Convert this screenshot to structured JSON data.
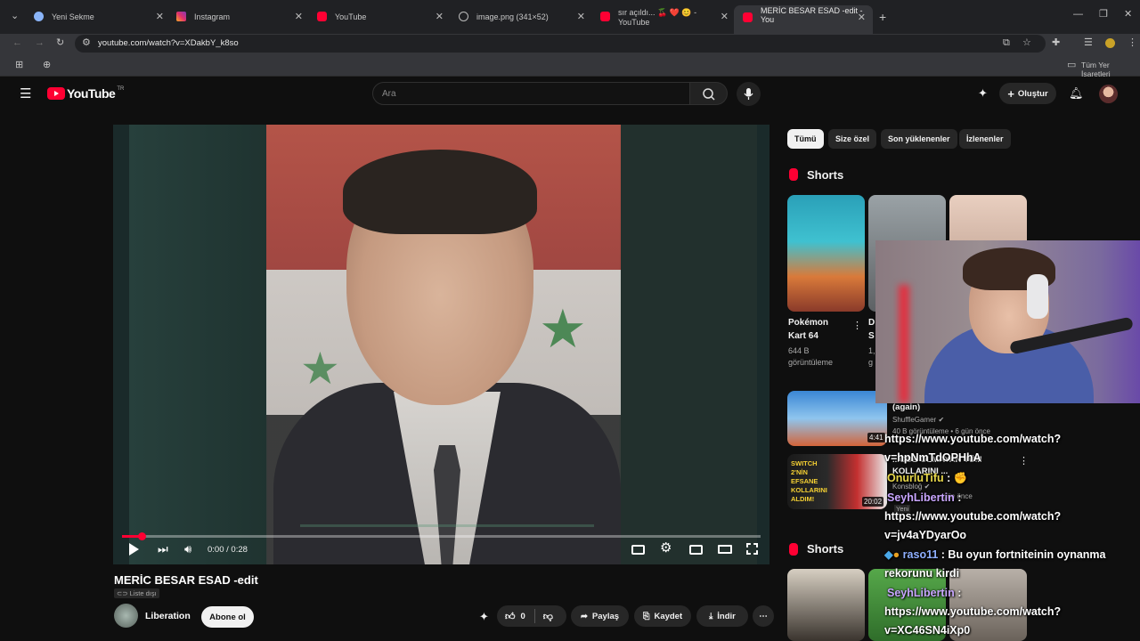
{
  "browser": {
    "tabs": [
      {
        "title": "Yeni Sekme"
      },
      {
        "title": "Instagram"
      },
      {
        "title": "YouTube"
      },
      {
        "title": "image.png (341×52)"
      },
      {
        "title": "sır açıldı... 🍒 ❤️ 😊 - YouTube"
      },
      {
        "title": "MERİC BESAR ESAD -edit - You"
      }
    ],
    "url": "youtube.com/watch?v=XDakbY_k8so",
    "bookmarks_folder": "Tüm Yer İşaretleri"
  },
  "youtube": {
    "logo": "YouTube",
    "region": "TR",
    "search_placeholder": "Ara",
    "create_label": "Oluştur",
    "chips": [
      "Tümü",
      "Size özel",
      "Son yüklenenler",
      "İzlenenler"
    ],
    "shorts_heading": "Shorts",
    "shorts_heading_2": "Shorts",
    "shorts": [
      {
        "title_line1": "Pokémon",
        "title_line2": "Kart 64",
        "views_line1": "644 B",
        "views_line2": "görüntüleme"
      },
      {
        "title_line1": "D",
        "title_line2": "S",
        "views_line1": "1,",
        "views_line2": "g"
      }
    ],
    "recs": [
      {
        "title": "(again)",
        "channel": "ShuffleGamer",
        "meta": "40 B görüntüleme • 6 gün önce",
        "duration": "4:41"
      },
      {
        "title": "...ODE OLMAYAN TÜM KOLLARINI ...",
        "channel": "Konsbloğ",
        "meta": "... gün önce",
        "badge": "Yeni",
        "duration": "20:02",
        "thumb_text": "SWITCH 2'NİN EFSANE KOLLARINI ALDIM!"
      }
    ]
  },
  "video": {
    "time": "0:00 / 0:28",
    "title": "MERİC BESAR ESAD -edit",
    "visibility": "Liste dışı",
    "channel": "Liberation",
    "subscribe": "Abone ol",
    "likes": "0",
    "share": "Paylaş",
    "save": "Kaydet",
    "download": "İndir",
    "progress": 0.03
  },
  "chat": {
    "lines": [
      {
        "user": "",
        "text": "https://www.youtube.com/watch?"
      },
      {
        "user": "",
        "text": "v=hpNmTdOPHhA"
      },
      {
        "user": "OnurluTifu",
        "text": ":"
      },
      {
        "user": "SeyhLibertin",
        "text": ":"
      },
      {
        "user": "",
        "text": "https://www.youtube.com/watch?"
      },
      {
        "user": "",
        "text": "v=jv4aYDyarOo"
      },
      {
        "user": "raso11",
        "text": ": Bu oyun fortniteinin oynanma"
      },
      {
        "user": "",
        "text": "rekorunu kirdi"
      },
      {
        "user": "SeyhLibertin",
        "text": ":"
      },
      {
        "user": "",
        "text": "https://www.youtube.com/watch?"
      },
      {
        "user": "",
        "text": "v=XC46SN4iXp0"
      }
    ]
  },
  "colors": {
    "accent_red": "#ff0033",
    "chat_user": "#c9a6ff"
  }
}
